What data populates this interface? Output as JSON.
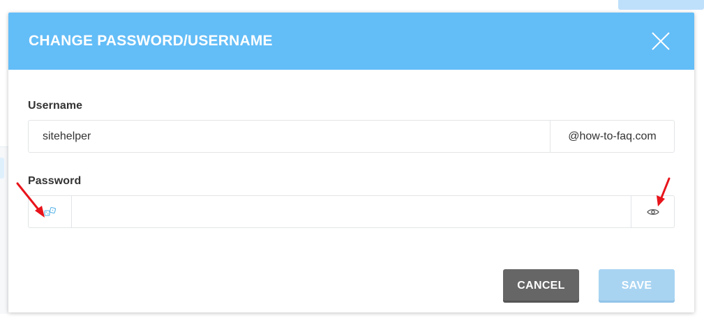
{
  "modal": {
    "title": "CHANGE PASSWORD/USERNAME"
  },
  "username": {
    "label": "Username",
    "value": "sitehelper",
    "domain_suffix": "@how-to-faq.com"
  },
  "password": {
    "label": "Password",
    "value": "",
    "generate_icon": "dice-icon",
    "toggle_icon": "eye-icon"
  },
  "footer": {
    "cancel_label": "CANCEL",
    "save_label": "SAVE"
  },
  "colors": {
    "header": "#63bdf7",
    "cancel": "#666666",
    "save_disabled": "#a8d4f2",
    "annotation": "#e8141b",
    "icon_accent": "#5ab4e8"
  }
}
